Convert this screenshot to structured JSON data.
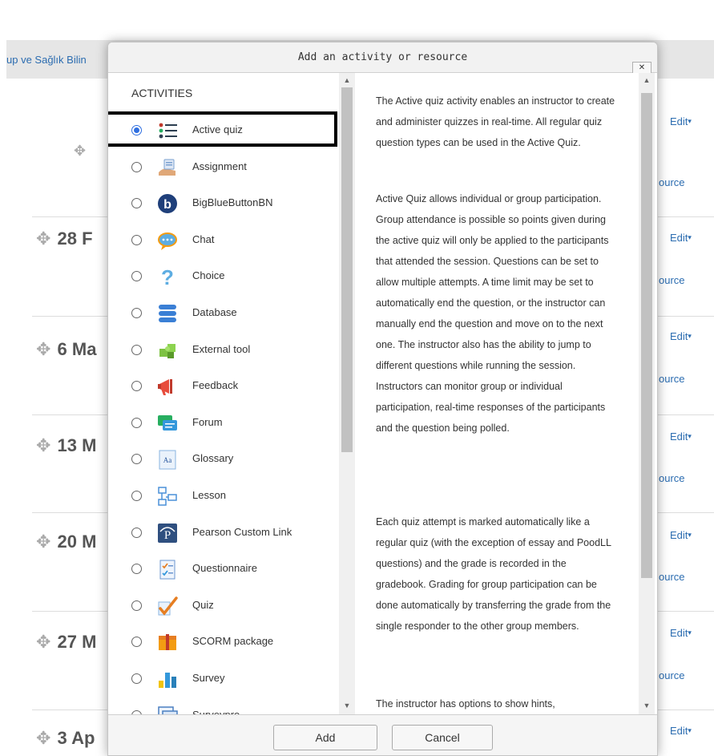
{
  "background": {
    "breadcrumb": "up ve Sağlık Bilin",
    "weeks": [
      "28 F",
      "6 Ma",
      "13 M",
      "20 M",
      "27 M",
      "3 Ap"
    ],
    "edit_label": "Edit",
    "resource_fragment": "ource"
  },
  "dialog": {
    "title": "Add an activity or resource",
    "close_label": "✕",
    "activities_heading": "ACTIVITIES",
    "selected": "Active quiz",
    "options": [
      {
        "label": "Active quiz",
        "icon": "active-quiz-icon",
        "selected": true
      },
      {
        "label": "Assignment",
        "icon": "assignment-icon",
        "selected": false
      },
      {
        "label": "BigBlueButtonBN",
        "icon": "bigbluebutton-icon",
        "selected": false
      },
      {
        "label": "Chat",
        "icon": "chat-icon",
        "selected": false
      },
      {
        "label": "Choice",
        "icon": "choice-icon",
        "selected": false
      },
      {
        "label": "Database",
        "icon": "database-icon",
        "selected": false
      },
      {
        "label": "External tool",
        "icon": "external-tool-icon",
        "selected": false
      },
      {
        "label": "Feedback",
        "icon": "feedback-icon",
        "selected": false
      },
      {
        "label": "Forum",
        "icon": "forum-icon",
        "selected": false
      },
      {
        "label": "Glossary",
        "icon": "glossary-icon",
        "selected": false
      },
      {
        "label": "Lesson",
        "icon": "lesson-icon",
        "selected": false
      },
      {
        "label": "Pearson Custom Link",
        "icon": "pearson-icon",
        "selected": false
      },
      {
        "label": "Questionnaire",
        "icon": "questionnaire-icon",
        "selected": false
      },
      {
        "label": "Quiz",
        "icon": "quiz-icon",
        "selected": false
      },
      {
        "label": "SCORM package",
        "icon": "scorm-icon",
        "selected": false
      },
      {
        "label": "Survey",
        "icon": "survey-icon",
        "selected": false
      },
      {
        "label": "Surveypro",
        "icon": "surveypro-icon",
        "selected": false
      }
    ],
    "description": [
      "The Active quiz activity enables an instructor to create and administer quizzes in real-time. All regular quiz question types can be used in the Active Quiz.",
      "Active Quiz allows individual or group participation. Group attendance is possible so points given during the active quiz will only be applied to the participants that attended the session. Questions can be set to allow multiple attempts. A time limit may be set to automatically end the question, or the instructor can manually end the question and move on to the next one. The instructor also has the ability to jump to different questions while running the session. Instructors can monitor group or individual participation, real-time responses of the participants and the question being polled.",
      "Each quiz attempt is marked automatically like a regular quiz (with the exception of essay and PoodLL questions) and the grade is recorded in the gradebook. Grading for group participation can be done automatically by transferring the grade from the single responder to the other group members.",
      "The instructor has options to show hints,"
    ],
    "buttons": {
      "add": "Add",
      "cancel": "Cancel"
    }
  }
}
